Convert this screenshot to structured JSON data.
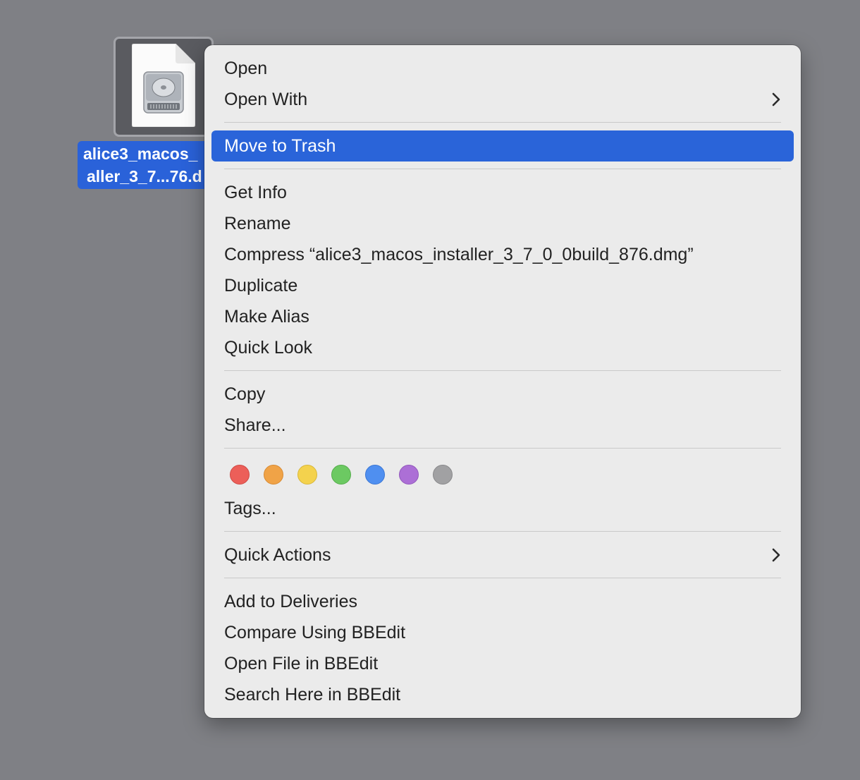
{
  "desktop": {
    "file": {
      "label_line1": "alice3_macos_",
      "label_line2": "aller_3_7...76.d",
      "icon": "disk-image-icon"
    }
  },
  "context_menu": {
    "group1": [
      {
        "label": "Open",
        "submenu": false
      },
      {
        "label": "Open With",
        "submenu": true
      }
    ],
    "group2": [
      {
        "label": "Move to Trash",
        "selected": true
      }
    ],
    "group3": [
      {
        "label": "Get Info"
      },
      {
        "label": "Rename"
      },
      {
        "label": "Compress “alice3_macos_installer_3_7_0_0build_876.dmg”"
      },
      {
        "label": "Duplicate"
      },
      {
        "label": "Make Alias"
      },
      {
        "label": "Quick Look"
      }
    ],
    "group4": [
      {
        "label": "Copy"
      },
      {
        "label": "Share..."
      }
    ],
    "tags": {
      "colors": [
        {
          "name": "red",
          "fill": "#ec5f59",
          "border": "#cf4a45"
        },
        {
          "name": "orange",
          "fill": "#f0a347",
          "border": "#d78a33"
        },
        {
          "name": "yellow",
          "fill": "#f4d24d",
          "border": "#d8b73a"
        },
        {
          "name": "green",
          "fill": "#6cc962",
          "border": "#55ad4c"
        },
        {
          "name": "blue",
          "fill": "#4f8ff0",
          "border": "#3a76d4"
        },
        {
          "name": "purple",
          "fill": "#ac6fd6",
          "border": "#9258bc"
        },
        {
          "name": "gray",
          "fill": "#a1a1a3",
          "border": "#88888a"
        }
      ],
      "label": "Tags..."
    },
    "group5": [
      {
        "label": "Quick Actions",
        "submenu": true
      }
    ],
    "group6": [
      {
        "label": "Add to Deliveries"
      },
      {
        "label": "Compare Using BBEdit"
      },
      {
        "label": "Open File in BBEdit"
      },
      {
        "label": "Search Here in BBEdit"
      }
    ]
  },
  "colors": {
    "desktop_bg": "#7f8085",
    "menu_bg": "#ebebeb",
    "selection": "#2a64d9"
  }
}
